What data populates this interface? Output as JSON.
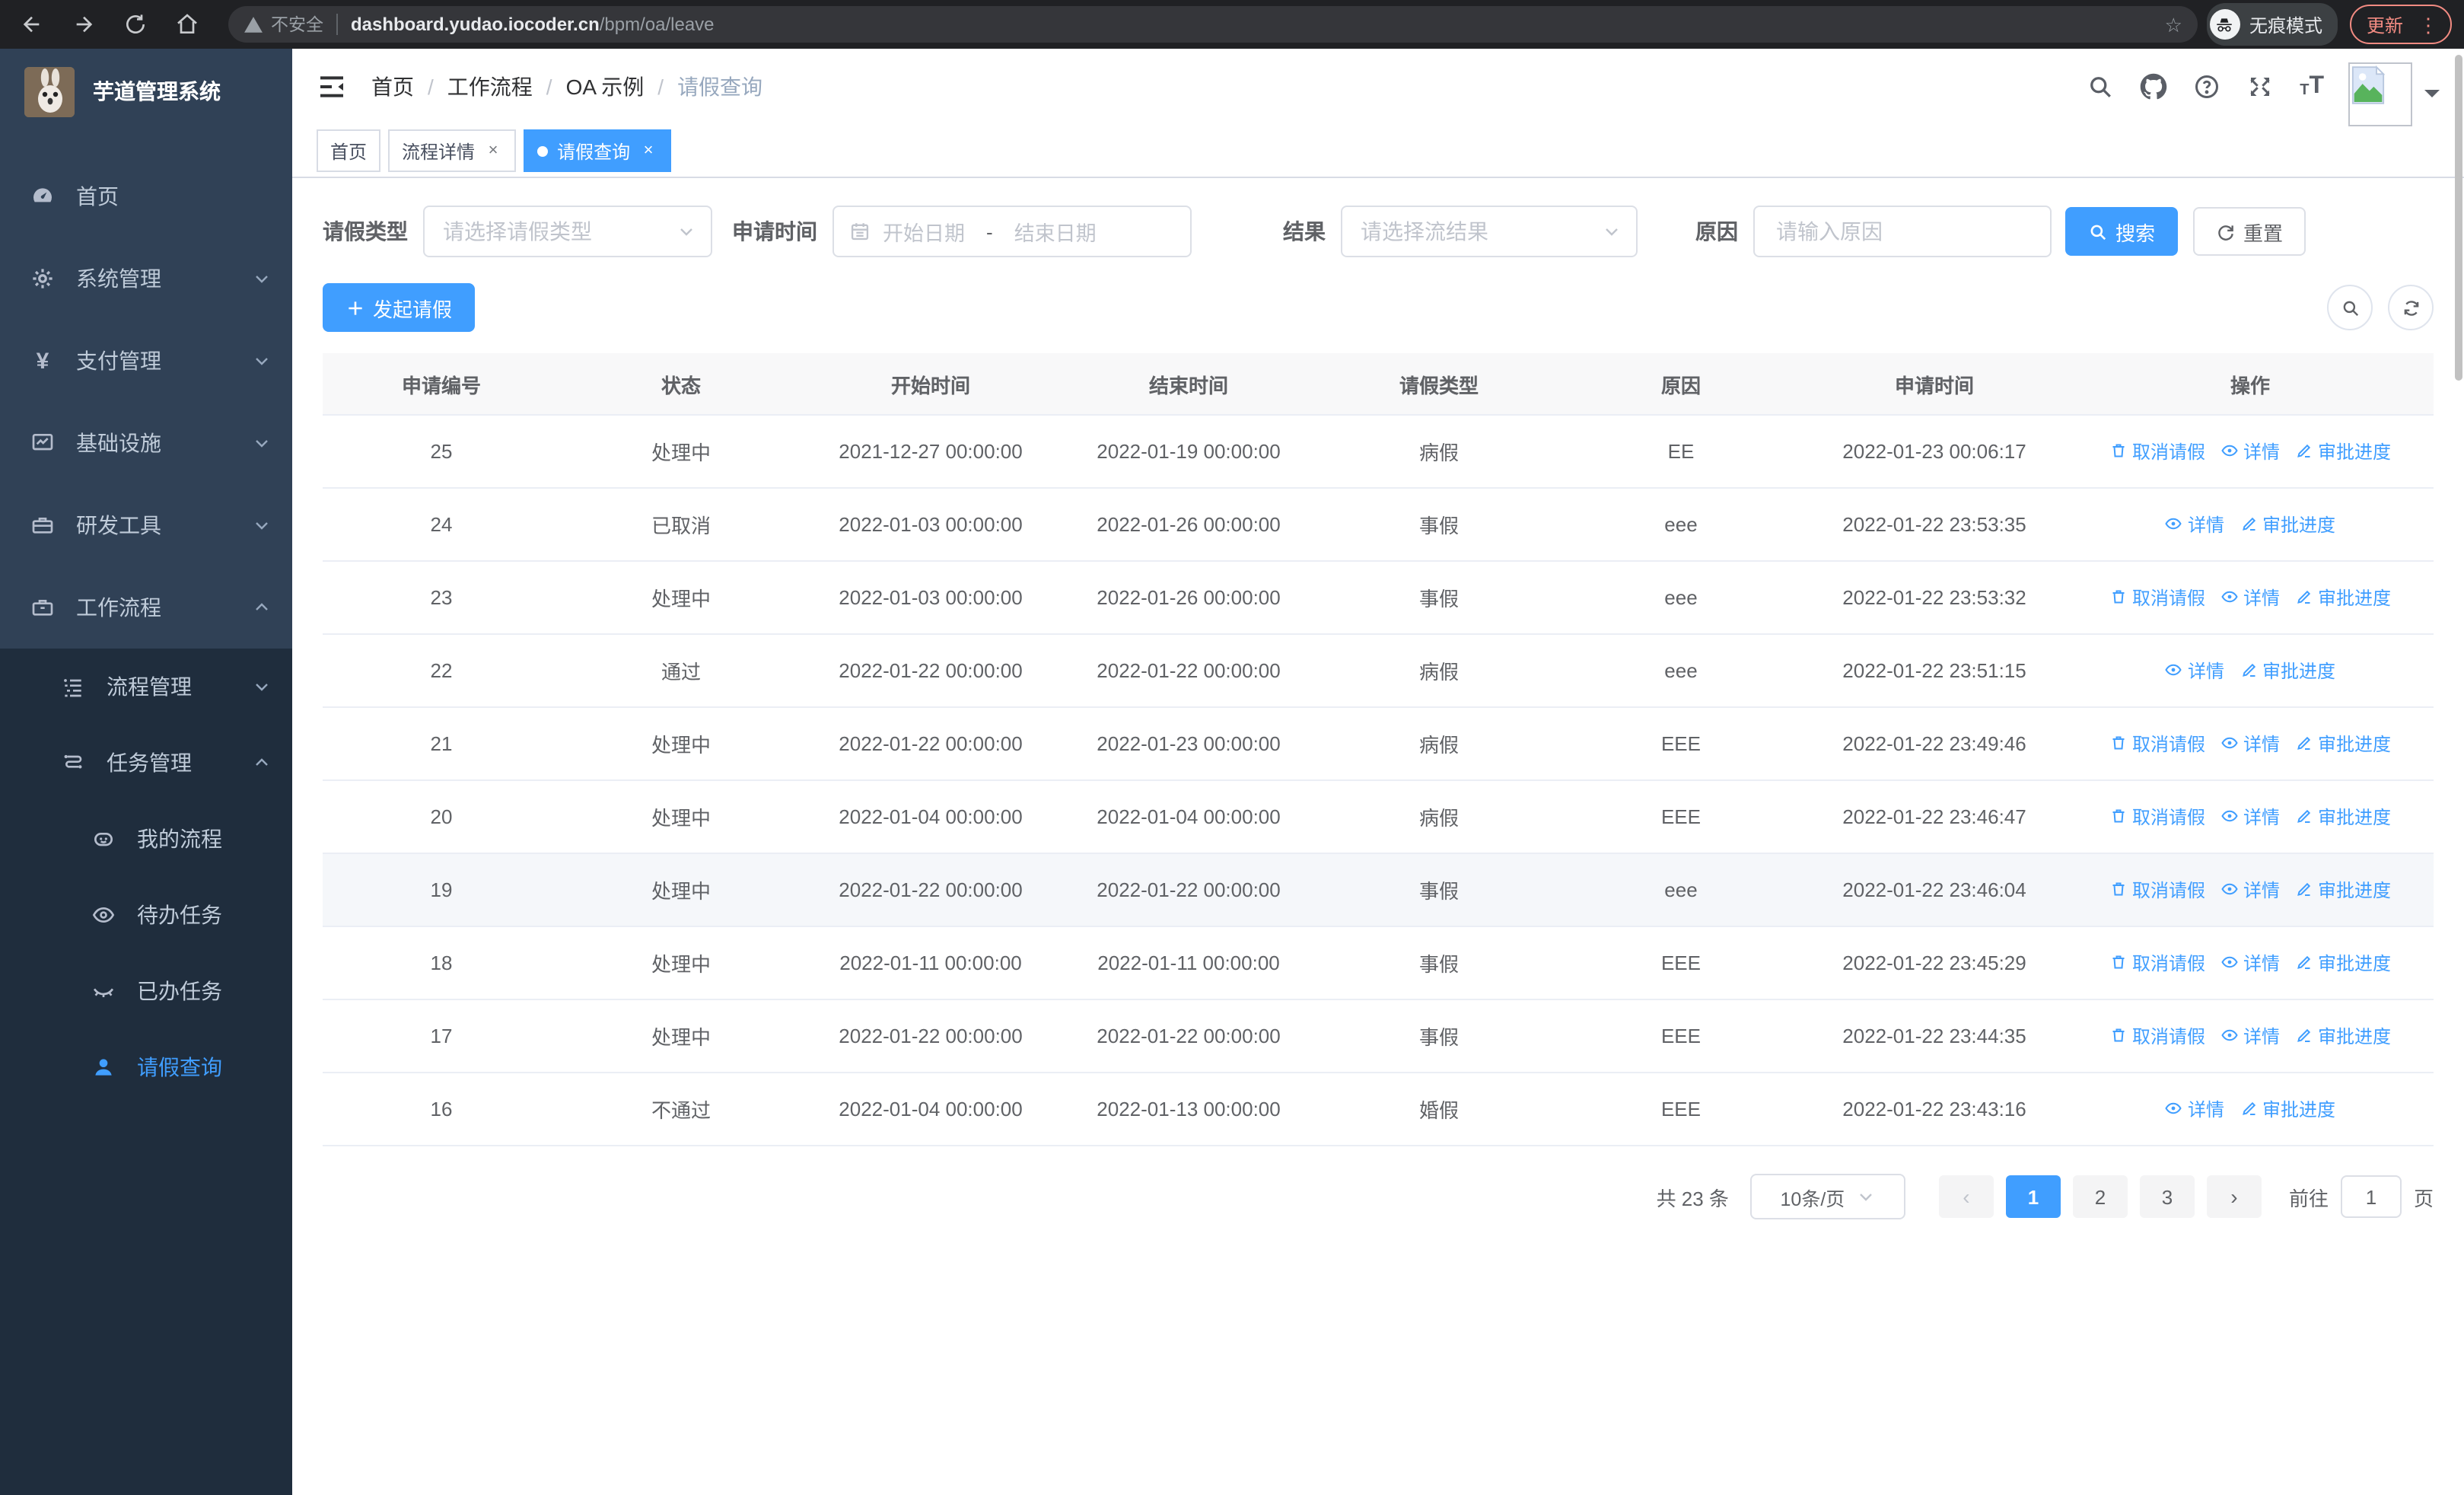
{
  "colors": {
    "accent": "#409eff",
    "sidebar_bg": "#304156",
    "submenu_bg": "#1f2d3d",
    "browser_bar_bg": "#202124",
    "update_accent": "#f28b82",
    "table_header_bg": "#f8f8f9",
    "row_highlight": "#f5f7fa"
  },
  "browser": {
    "security_warning": "不安全",
    "url_host": "dashboard.yudao.iocoder.cn",
    "url_path": "/bpm/oa/leave",
    "incognito_label": "无痕模式",
    "update_label": "更新"
  },
  "sidebar": {
    "app_title": "芋道管理系统",
    "items": [
      {
        "label": "首页",
        "icon": "dashboard-icon"
      },
      {
        "label": "系统管理",
        "icon": "gear-icon"
      },
      {
        "label": "支付管理",
        "icon": "yen-icon"
      },
      {
        "label": "基础设施",
        "icon": "infrastructure-icon"
      },
      {
        "label": "研发工具",
        "icon": "devtools-icon"
      },
      {
        "label": "工作流程",
        "icon": "workflow-icon",
        "expanded": true,
        "children": [
          {
            "label": "流程管理",
            "icon": "process-list-icon"
          },
          {
            "label": "任务管理",
            "icon": "task-route-icon",
            "expanded": true,
            "children": [
              {
                "label": "我的流程",
                "icon": "my-process-icon"
              },
              {
                "label": "待办任务",
                "icon": "todo-eye-icon"
              },
              {
                "label": "已办任务",
                "icon": "done-eye-icon"
              },
              {
                "label": "请假查询",
                "icon": "leave-user-icon",
                "active": true
              }
            ]
          }
        ]
      }
    ]
  },
  "header": {
    "breadcrumb": [
      {
        "label": "首页"
      },
      {
        "label": "工作流程"
      },
      {
        "label": "OA 示例"
      },
      {
        "label": "请假查询",
        "current": true
      }
    ]
  },
  "tabs": [
    {
      "label": "首页",
      "closable": false,
      "active": false
    },
    {
      "label": "流程详情",
      "closable": true,
      "active": false
    },
    {
      "label": "请假查询",
      "closable": true,
      "active": true
    }
  ],
  "filters": {
    "leave_type_label": "请假类型",
    "leave_type_placeholder": "请选择请假类型",
    "apply_time_label": "申请时间",
    "start_date_placeholder": "开始日期",
    "range_separator": "-",
    "end_date_placeholder": "结束日期",
    "result_label": "结果",
    "result_placeholder": "请选择流结果",
    "reason_label": "原因",
    "reason_placeholder": "请输入原因",
    "search_label": "搜索",
    "reset_label": "重置"
  },
  "toolbar": {
    "create_label": "发起请假"
  },
  "table": {
    "columns": [
      "申请编号",
      "状态",
      "开始时间",
      "结束时间",
      "请假类型",
      "原因",
      "申请时间",
      "操作"
    ],
    "action_labels": {
      "cancel": "取消请假",
      "detail": "详情",
      "progress": "审批进度"
    },
    "rows": [
      {
        "id": "25",
        "status": "处理中",
        "start": "2021-12-27 00:00:00",
        "end": "2022-01-19 00:00:00",
        "type": "病假",
        "reason": "EE",
        "apply_time": "2022-01-23 00:06:17",
        "highlight": false,
        "actions": [
          "cancel",
          "detail",
          "progress"
        ]
      },
      {
        "id": "24",
        "status": "已取消",
        "start": "2022-01-03 00:00:00",
        "end": "2022-01-26 00:00:00",
        "type": "事假",
        "reason": "eee",
        "apply_time": "2022-01-22 23:53:35",
        "highlight": false,
        "actions": [
          "detail",
          "progress"
        ]
      },
      {
        "id": "23",
        "status": "处理中",
        "start": "2022-01-03 00:00:00",
        "end": "2022-01-26 00:00:00",
        "type": "事假",
        "reason": "eee",
        "apply_time": "2022-01-22 23:53:32",
        "highlight": false,
        "actions": [
          "cancel",
          "detail",
          "progress"
        ]
      },
      {
        "id": "22",
        "status": "通过",
        "start": "2022-01-22 00:00:00",
        "end": "2022-01-22 00:00:00",
        "type": "病假",
        "reason": "eee",
        "apply_time": "2022-01-22 23:51:15",
        "highlight": false,
        "actions": [
          "detail",
          "progress"
        ]
      },
      {
        "id": "21",
        "status": "处理中",
        "start": "2022-01-22 00:00:00",
        "end": "2022-01-23 00:00:00",
        "type": "病假",
        "reason": "EEE",
        "apply_time": "2022-01-22 23:49:46",
        "highlight": false,
        "actions": [
          "cancel",
          "detail",
          "progress"
        ]
      },
      {
        "id": "20",
        "status": "处理中",
        "start": "2022-01-04 00:00:00",
        "end": "2022-01-04 00:00:00",
        "type": "病假",
        "reason": "EEE",
        "apply_time": "2022-01-22 23:46:47",
        "highlight": false,
        "actions": [
          "cancel",
          "detail",
          "progress"
        ]
      },
      {
        "id": "19",
        "status": "处理中",
        "start": "2022-01-22 00:00:00",
        "end": "2022-01-22 00:00:00",
        "type": "事假",
        "reason": "eee",
        "apply_time": "2022-01-22 23:46:04",
        "highlight": true,
        "actions": [
          "cancel",
          "detail",
          "progress"
        ]
      },
      {
        "id": "18",
        "status": "处理中",
        "start": "2022-01-11 00:00:00",
        "end": "2022-01-11 00:00:00",
        "type": "事假",
        "reason": "EEE",
        "apply_time": "2022-01-22 23:45:29",
        "highlight": false,
        "actions": [
          "cancel",
          "detail",
          "progress"
        ]
      },
      {
        "id": "17",
        "status": "处理中",
        "start": "2022-01-22 00:00:00",
        "end": "2022-01-22 00:00:00",
        "type": "事假",
        "reason": "EEE",
        "apply_time": "2022-01-22 23:44:35",
        "highlight": false,
        "actions": [
          "cancel",
          "detail",
          "progress"
        ]
      },
      {
        "id": "16",
        "status": "不通过",
        "start": "2022-01-04 00:00:00",
        "end": "2022-01-13 00:00:00",
        "type": "婚假",
        "reason": "EEE",
        "apply_time": "2022-01-22 23:43:16",
        "highlight": false,
        "actions": [
          "detail",
          "progress"
        ]
      }
    ]
  },
  "pagination": {
    "total_label": "共 23 条",
    "page_size_label": "10条/页",
    "pages": [
      "1",
      "2",
      "3"
    ],
    "active_page": "1",
    "prev_arrow": "‹",
    "next_arrow": "›",
    "goto_label": "前往",
    "goto_value": "1",
    "page_unit": "页"
  }
}
